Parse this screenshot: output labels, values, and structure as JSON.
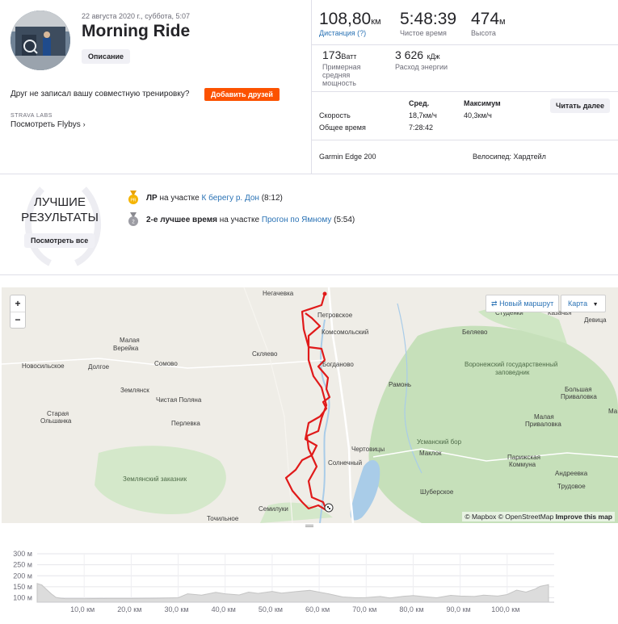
{
  "activity": {
    "date": "22 августа 2020 г., суббота, 5:07",
    "title": "Morning Ride",
    "description_button": "Описание"
  },
  "friends": {
    "question": "Друг не записал вашу совместную тренировку?",
    "add_button": "Добавить друзей"
  },
  "labs": {
    "tag": "STRAVA LABS",
    "flybys": "Посмотреть Flybys"
  },
  "stats": {
    "distance_value": "108,80",
    "distance_unit": "км",
    "distance_label": "Дистанция (?)",
    "moving_time_value": "5:48:39",
    "moving_time_label": "Чистое время",
    "elevation_value": "474",
    "elevation_unit": "м",
    "elevation_label": "Высота",
    "power_value": "173",
    "power_unit": "Ватт",
    "power_label_1": "Примерная",
    "power_label_2": "средняя",
    "power_label_3": "мощность",
    "energy_value": "3 626",
    "energy_unit": "кДж",
    "energy_label": "Расход энергии"
  },
  "details": {
    "col_avg": "Сред.",
    "col_max": "Максимум",
    "read_more": "Читать далее",
    "speed_label": "Скорость",
    "speed_avg": "18,7км/ч",
    "speed_max": "40,3км/ч",
    "total_time_label": "Общее время",
    "total_time": "7:28:42",
    "device": "Garmin Edge 200",
    "bike": "Велосипед: Хардтейл"
  },
  "best": {
    "badge_line1": "ЛУЧШИЕ",
    "badge_line2": "РЕЗУЛЬТАТЫ",
    "view_all": "Посмотреть все",
    "item1_medal": "PR",
    "item1_bold": "ЛР",
    "item1_pre": "на участке",
    "item1_link": "К берегу р. Дон",
    "item1_time": "(8:12)",
    "item2_medal": "2",
    "item2_bold": "2-е лучшее время",
    "item2_pre": "на участке",
    "item2_link": "Прогон по Ямному",
    "item2_time": "(5:54)"
  },
  "map": {
    "zoom_in": "+",
    "zoom_out": "−",
    "new_route": "Новый маршрут",
    "map_type": "Карта",
    "attribution_mapbox": "© Mapbox",
    "attribution_osm": "© OpenStreetMap",
    "attribution_improve": "Improve this map",
    "places": {
      "negachevka": "Негачевка",
      "petrovskoe": "Петровское",
      "studenki": "Студенки",
      "kazachya": "Казачья",
      "devitsa": "Девица",
      "komsomolsky": "Комсомольский",
      "belyaevo": "Беляево",
      "malaya_vereyka_1": "Малая",
      "malaya_vereyka_2": "Верейка",
      "sklyaevo": "Скляево",
      "novosilskoe": "Новосильское",
      "dolgoe": "Долгое",
      "somovo": "Сомово",
      "bogdanovo": "Богданово",
      "reserve_1": "Воронежский государственный",
      "reserve_2": "заповедник",
      "ramon": "Рамонь",
      "zemlyansk": "Землянск",
      "chistaya_polyana": "Чистая Поляна",
      "bolshaya_privalovka_1": "Большая",
      "bolshaya_privalovka_2": "Приваловка",
      "staraya_olshanka_1": "Старая",
      "staraya_olshanka_2": "Ольшанка",
      "perlevka": "Перлевка",
      "malaya_privalovka_1": "Малая",
      "malaya_privalovka_2": "Приваловка",
      "ma": "Ма",
      "chertovitsy": "Чертовицы",
      "usmansky_bor": "Усманский бор",
      "maklok": "Маклок",
      "solnechny": "Солнечный",
      "parizhskaya_1": "Парижская",
      "parizhskaya_2": "Коммуна",
      "andreevka": "Андреевка",
      "zemlyansky_zakaznik": "Землянский заказник",
      "trudovoe": "Трудовое",
      "shuberskoe": "Шуберское",
      "semiluki": "Семилуки",
      "tochilnoe": "Точильное"
    }
  },
  "elevation_chart": {
    "y_ticks": [
      "300 м",
      "250 м",
      "200 м",
      "150 м",
      "100 м"
    ],
    "x_ticks": [
      "10,0 км",
      "20,0 км",
      "30,0 км",
      "40,0 км",
      "50,0 км",
      "60,0 км",
      "70,0 км",
      "80,0 км",
      "90,0 км",
      "100,0 км"
    ]
  },
  "chart_data": {
    "type": "area",
    "xlabel": "",
    "ylabel": "",
    "xlim": [
      0,
      110
    ],
    "ylim": [
      80,
      300
    ],
    "x_tick_values": [
      10,
      20,
      30,
      40,
      50,
      60,
      70,
      80,
      90,
      100
    ],
    "y_tick_values": [
      300,
      250,
      200,
      150,
      100
    ],
    "grid": true,
    "x": [
      0,
      1,
      2,
      3,
      4,
      5,
      6,
      8,
      10,
      15,
      20,
      25,
      30,
      32,
      35,
      38,
      40,
      43,
      45,
      47,
      50,
      52,
      55,
      58,
      60,
      62,
      65,
      68,
      70,
      73,
      75,
      78,
      80,
      83,
      85,
      88,
      90,
      93,
      95,
      98,
      100,
      102,
      104,
      106,
      107,
      108.8
    ],
    "values": [
      165,
      158,
      138,
      118,
      102,
      98,
      96,
      96,
      96,
      97,
      97,
      98,
      100,
      118,
      112,
      125,
      118,
      113,
      126,
      120,
      129,
      121,
      128,
      134,
      126,
      118,
      104,
      100,
      101,
      106,
      99,
      107,
      110,
      104,
      100,
      111,
      108,
      106,
      112,
      108,
      115,
      135,
      126,
      140,
      152,
      160
    ]
  },
  "colors": {
    "accent_orange": "#fc5200",
    "route_red": "#e01a1a",
    "link_blue": "#2a72b5",
    "map_green": "#c9e3bf",
    "map_water": "#a9cce8",
    "chart_fill": "#dcdcdc"
  }
}
